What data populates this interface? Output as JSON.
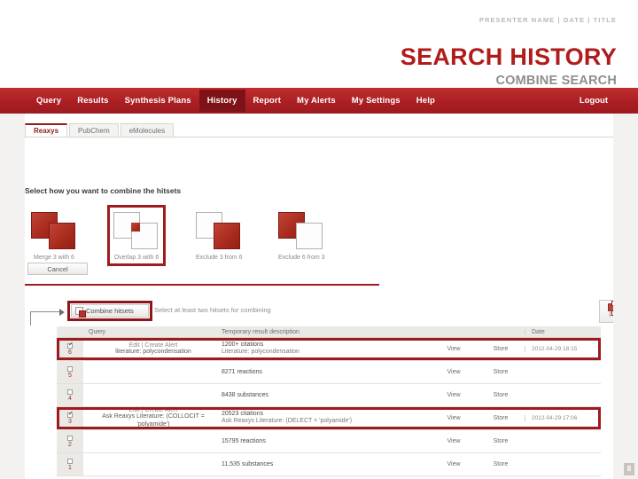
{
  "slide": {
    "meta": "PRESENTER NAME | DATE | TITLE",
    "title": "SEARCH HISTORY",
    "subtitle": "COMBINE SEARCH",
    "page_number": "8"
  },
  "nav": {
    "items": [
      {
        "label": "Query",
        "active": false
      },
      {
        "label": "Results",
        "active": false
      },
      {
        "label": "Synthesis Plans",
        "active": false
      },
      {
        "label": "History",
        "active": true
      },
      {
        "label": "Report",
        "active": false
      },
      {
        "label": "My Alerts",
        "active": false
      },
      {
        "label": "My Settings",
        "active": false
      },
      {
        "label": "Help",
        "active": false
      }
    ],
    "logout": "Logout"
  },
  "tabs": [
    {
      "label": "Reaxys",
      "active": true
    },
    {
      "label": "PubChem",
      "active": false
    },
    {
      "label": "eMolecules",
      "active": false
    }
  ],
  "combine_panel": {
    "instruction": "Select how you want to combine the hitsets",
    "options": [
      {
        "caption": "Merge 3 with 6",
        "selected": false
      },
      {
        "caption": "Overlap 3 with 6",
        "selected": true
      },
      {
        "caption": "Exclude 3 from 6",
        "selected": false
      },
      {
        "caption": "Exclude 6 from 3",
        "selected": false
      }
    ],
    "cancel_label": "Cancel"
  },
  "actions": {
    "combine_label": "Combine hitsets",
    "combine_hint": "Select at least two hitsets for combining",
    "print_label": "Print"
  },
  "results_table": {
    "columns": {
      "check": "",
      "query": "Query",
      "description": "Temporary result description",
      "view": "",
      "store": "",
      "date": "Date"
    },
    "view_label": "View",
    "store_label": "Store",
    "rows": [
      {
        "id": "6",
        "checked": true,
        "highlighted": true,
        "query_actions": "Edit | Create Alert",
        "query_text": "literature: polycondensation",
        "result_count": "1200+ citations",
        "result_sub": "Literature: polycondensation",
        "date": "2012-04-29 18:15"
      },
      {
        "id": "5",
        "checked": false,
        "highlighted": false,
        "query_actions": "",
        "query_text": "",
        "result_count": "8271 reactions",
        "result_sub": "",
        "date": ""
      },
      {
        "id": "4",
        "checked": false,
        "highlighted": false,
        "query_actions": "",
        "query_text": "",
        "result_count": "8438 substances",
        "result_sub": "",
        "date": ""
      },
      {
        "id": "3",
        "checked": true,
        "highlighted": true,
        "query_actions": "Edit | Create Alert",
        "query_text": "Ask Reaxys Literature: (COLLOCIT = 'polyamide')",
        "result_count": "20523 citations",
        "result_sub": "Ask Reaxys Literature: (DELECT = 'polyamide')",
        "date": "2012-04-29 17:06"
      },
      {
        "id": "2",
        "checked": false,
        "highlighted": false,
        "query_actions": "",
        "query_text": "",
        "result_count": "15795 reactions",
        "result_sub": "",
        "date": ""
      },
      {
        "id": "1",
        "checked": false,
        "highlighted": false,
        "query_actions": "",
        "query_text": "",
        "result_count": "11,535 substances",
        "result_sub": "",
        "date": ""
      }
    ]
  }
}
